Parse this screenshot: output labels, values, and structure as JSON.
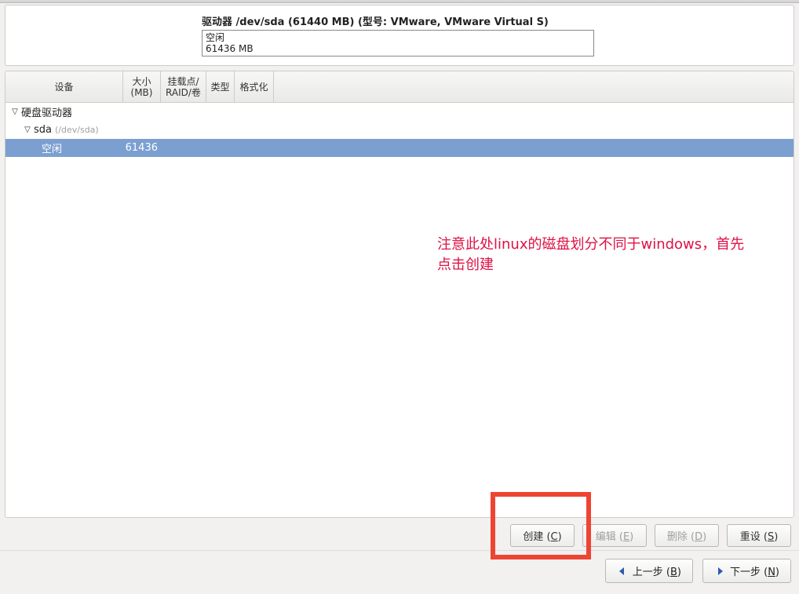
{
  "summary": {
    "title": "驱动器 /dev/sda (61440 MB) (型号: VMware, VMware Virtual S)",
    "bar_line1": "空闲",
    "bar_line2": "61436 MB"
  },
  "headers": {
    "device": "设备",
    "size_l1": "大小",
    "size_l2": "(MB)",
    "mount_l1": "挂载点/",
    "mount_l2": "RAID/卷",
    "type": "类型",
    "format": "格式化"
  },
  "tree": {
    "root_label": "硬盘驱动器",
    "sda_label": "sda",
    "sda_path": "(/dev/sda)",
    "free_label": "空闲",
    "free_size": "61436"
  },
  "annotation": {
    "line1": "注意此处linux的磁盘划分不同于windows，首先",
    "line2": "点击创建"
  },
  "buttons": {
    "create": "创建 (",
    "create_m": "C",
    "create_end": ")",
    "edit": "编辑 (",
    "edit_m": "E",
    "edit_end": ")",
    "delete": "删除 (",
    "delete_m": "D",
    "delete_end": ")",
    "reset": "重设 (",
    "reset_m": "S",
    "reset_end": ")"
  },
  "nav": {
    "back": "上一步 (",
    "back_m": "B",
    "back_end": ")",
    "next": "下一步 (",
    "next_m": "N",
    "next_end": ")"
  }
}
